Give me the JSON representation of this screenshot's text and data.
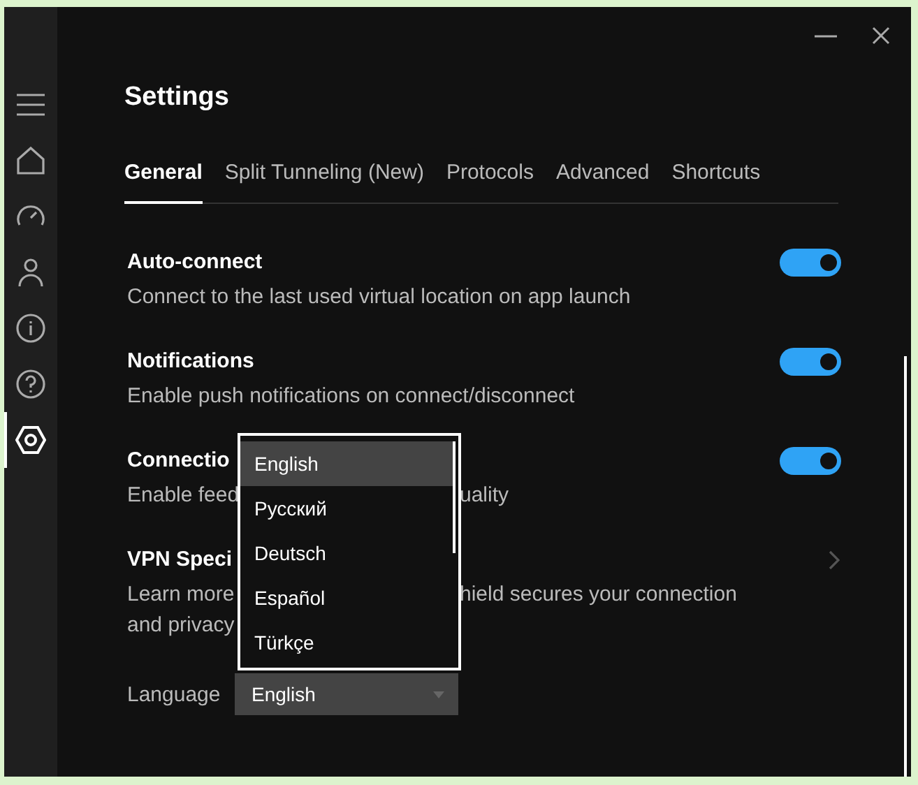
{
  "sidebar": {
    "items": [
      {
        "kind": "menu",
        "selected": false
      },
      {
        "kind": "home",
        "selected": false
      },
      {
        "kind": "speed",
        "selected": false
      },
      {
        "kind": "account",
        "selected": false
      },
      {
        "kind": "info",
        "selected": false
      },
      {
        "kind": "help",
        "selected": false
      },
      {
        "kind": "settings",
        "selected": true
      }
    ]
  },
  "title": "Settings",
  "tabs": [
    {
      "label": "General",
      "selected": true
    },
    {
      "label": "Split Tunneling (New)",
      "selected": false
    },
    {
      "label": "Protocols",
      "selected": false
    },
    {
      "label": "Advanced",
      "selected": false
    },
    {
      "label": "Shortcuts",
      "selected": false
    }
  ],
  "settings": [
    {
      "kind": "toggle",
      "title": "Auto-connect",
      "description": [
        [
          "Connect to the last used virtual location on app launch"
        ]
      ],
      "on": true
    },
    {
      "kind": "toggle",
      "title": "Notifications",
      "description": [
        [
          "Enable push notifications on connect/disconnect"
        ]
      ],
      "on": true
    },
    {
      "kind": "toggle",
      "title": "Connectio",
      "description": [
        [
          "Enable feed",
          "uality"
        ]
      ],
      "on": true
    },
    {
      "kind": "link",
      "title": "VPN Speci",
      "description": [
        [
          "Learn more",
          "hield secures your connection"
        ],
        [
          "and privacy"
        ]
      ]
    }
  ],
  "language": {
    "label": "Language",
    "value": "English",
    "options": [
      {
        "label": "English",
        "selected": true
      },
      {
        "label": "Русский",
        "selected": false
      },
      {
        "label": "Deutsch",
        "selected": false
      },
      {
        "label": "Español",
        "selected": false
      },
      {
        "label": "Türkçe",
        "selected": false
      }
    ]
  }
}
